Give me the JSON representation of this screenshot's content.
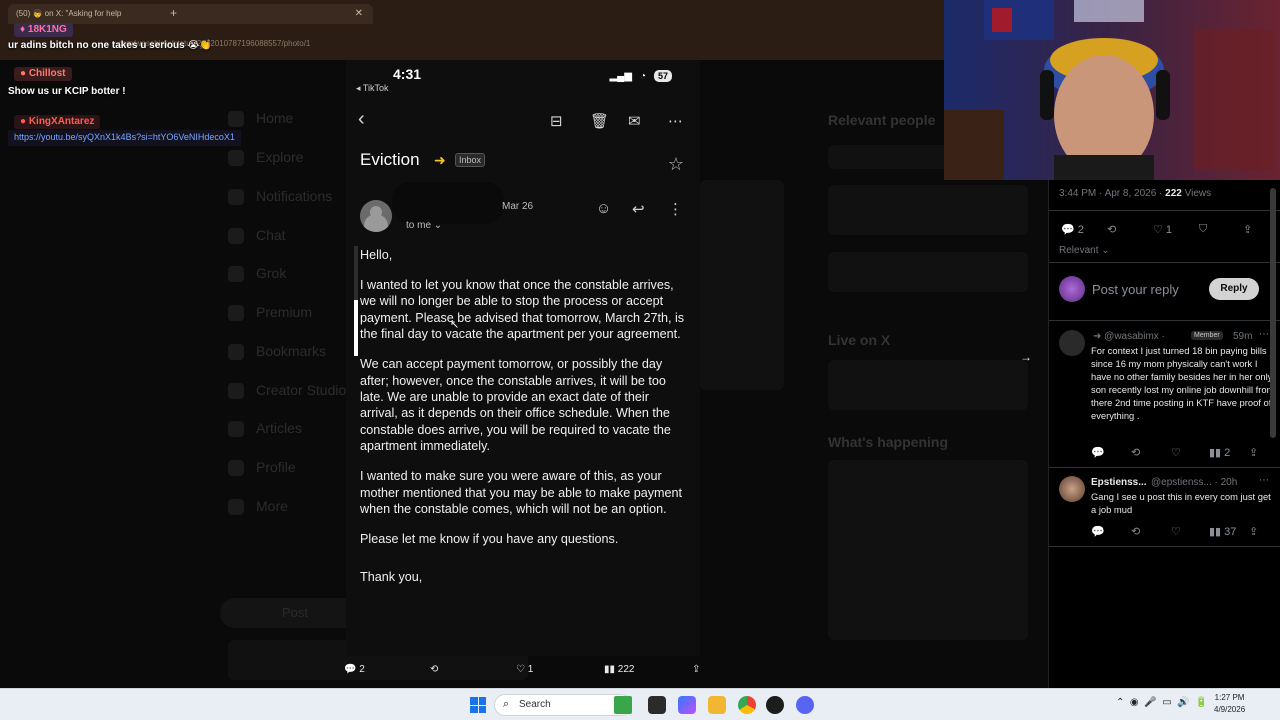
{
  "browser": {
    "tab_title": "(50) 👦 on X: \"Asking for help",
    "address": "x.com/wasabimx/status/2042010787196088557/photo/1"
  },
  "chat": {
    "line1": "ur adins bitch no one takes u serious 😭👏",
    "user1": "18K1NG",
    "user2": "Chillost",
    "line2": "Show us ur KCIP botter !",
    "user3": "KingXAntarez",
    "link": "https://youtu.be/syQXnX1k4Bs?si=htYO6VeNIHdecoX1"
  },
  "x_sidebar": {
    "items": [
      "Home",
      "Explore",
      "Notifications",
      "Chat",
      "Grok",
      "Premium",
      "Bookmarks",
      "Creator Studio",
      "Articles",
      "Profile",
      "More"
    ],
    "post_button": "Post"
  },
  "x_right_bg": {
    "relevant_people": "Relevant people",
    "live_on_x": "Live on X",
    "whats_happening": "What's happening"
  },
  "phone": {
    "time": "4:31",
    "battery": "57",
    "back_app": "◂ TikTok",
    "subject": "Eviction",
    "label": "Inbox",
    "date": "Mar 26",
    "recipient": "to me ⌄",
    "body": [
      "Hello,",
      "I wanted to let you know that once the constable arrives, we will no longer be able to stop the process or accept payment. Please be advised that tomorrow, March 27th, is the final day to vacate the apartment per your agreement.",
      "We can accept payment tomorrow, or possibly the day after; however, once the constable arrives, it will be too late. We are unable to provide an exact date of their arrival, as it depends on their office schedule. When the constable does arrive, you will be required to vacate the apartment immediately.",
      "I wanted to make sure you were aware of this, as your mother mentioned that you may be able to make payment when the constable comes, which will not be an option.",
      "Please let me know if you have any questions.",
      "Thank you,"
    ]
  },
  "post_stats": {
    "replies": "2",
    "reposts": "",
    "likes": "1",
    "views": "222"
  },
  "right_col": {
    "timestamp": "3:44 PM · Apr 8, 2026 · ",
    "views_count": "222",
    "views_label": " Views",
    "replies": "2",
    "likes": "1",
    "sort": "Relevant ⌄",
    "reply_placeholder": "Post your reply",
    "reply_button": "Reply",
    "reply1": {
      "handle": "@wasabimx ·",
      "badge": "Member",
      "time": "59m",
      "text": "For context I just turned 18 bin paying bills since 16 my mom physically can't work I have no other family besides her in her only son recently lost my online job downhill from there 2nd time posting in KTF have proof of everything .",
      "reposts": "",
      "likes": "",
      "views": "2"
    },
    "reply2": {
      "name": "Epstienss...",
      "handle": "@epstienss... · 20h",
      "text": "Gang I see u post this in every com just get a job mud",
      "views": "37"
    }
  },
  "taskbar": {
    "search": "Search",
    "time": "1:27 PM",
    "date": "4/9/2026"
  },
  "colors": {
    "accent_label": "#f7c12d",
    "x_background": "#000000",
    "taskbar": "#e9eef5"
  }
}
